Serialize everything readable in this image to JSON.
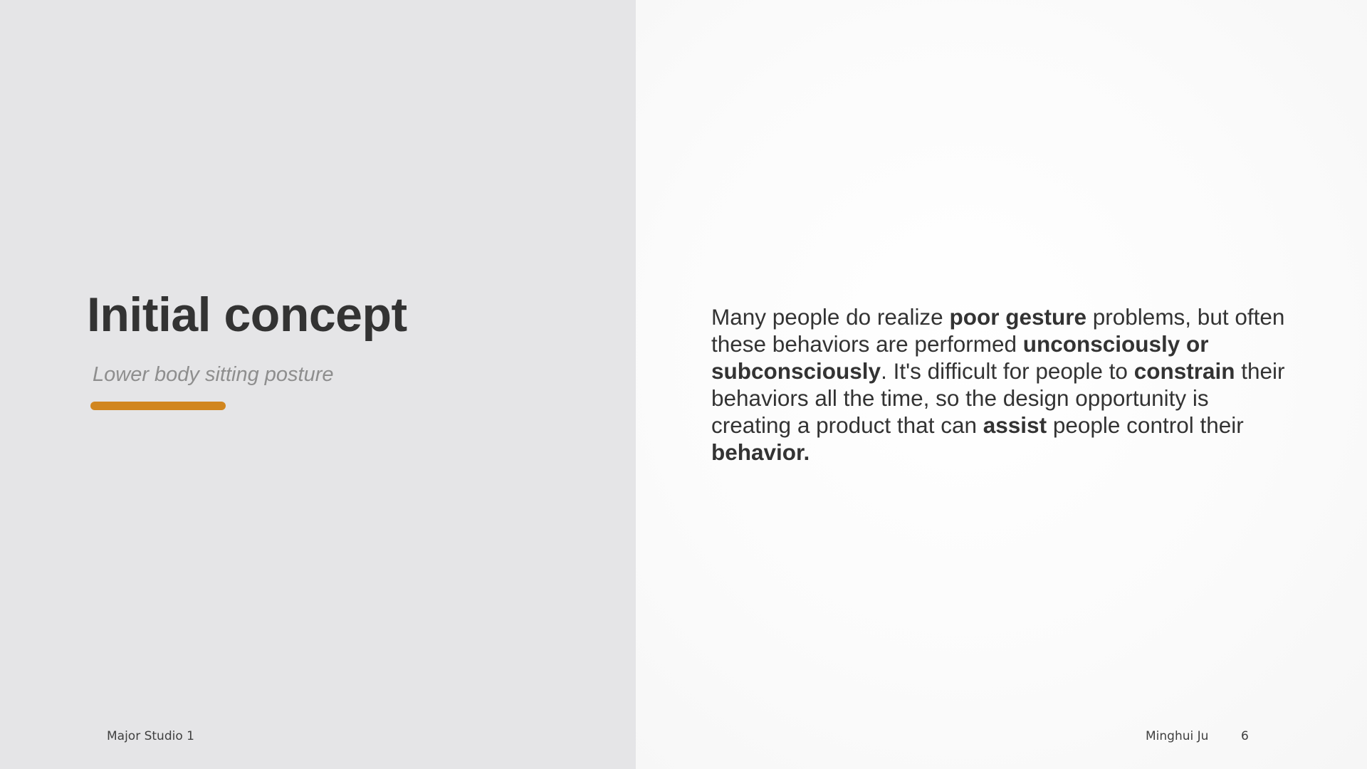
{
  "slide": {
    "title": "Initial concept",
    "subtitle": "Lower body sitting posture",
    "accent_color": "#d1861f",
    "body": [
      {
        "text": "Many people do realize ",
        "bold": false
      },
      {
        "text": "poor gesture",
        "bold": true
      },
      {
        "text": " problems, but often these behaviors are performed ",
        "bold": false
      },
      {
        "text": "unconsciously or subconsciously",
        "bold": true
      },
      {
        "text": ". It's difficult for people to ",
        "bold": false
      },
      {
        "text": "constrain",
        "bold": true
      },
      {
        "text": " their behaviors all the time, so the design opportunity is creating a product that can ",
        "bold": false
      },
      {
        "text": "assist",
        "bold": true
      },
      {
        "text": " people control their ",
        "bold": false
      },
      {
        "text": "behavior.",
        "bold": true
      }
    ]
  },
  "footer": {
    "course": "Major Studio 1",
    "author": "Minghui Ju",
    "page_number": "6"
  }
}
